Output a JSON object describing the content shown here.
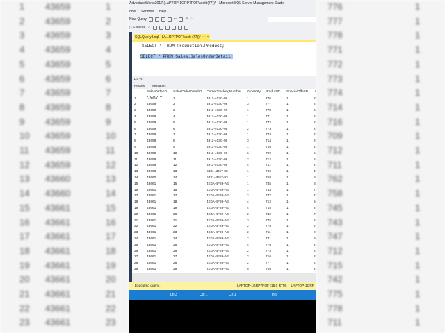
{
  "window": {
    "title": "AdventureWorks2017 (LAPTOP-1GRP7POF\\scott (77))* - Microsoft SQL Server Management Studio"
  },
  "menu": [
    "ools",
    "Window",
    "Help"
  ],
  "toolbar": {
    "new_query": "New Query",
    "execute": "Execute"
  },
  "tab": {
    "label": "SQLQuery3.sql - LA...RP7POF\\scott (77))*",
    "pin": "⊷",
    "close": "×"
  },
  "editor": {
    "line1": "SELECT * FROM Production.Product;",
    "line3": "SELECT * FROM Sales.SalesOrderDetail;"
  },
  "zoom": "110 %",
  "results_tabs": [
    "Results",
    "Messages"
  ],
  "columns": [
    "",
    "SalesOrderID",
    "SalesOrderDetailID",
    "CarrierTrackingNumber",
    "OrderQty",
    "ProductID",
    "SpecialOfferID",
    "U"
  ],
  "rows": [
    [
      "1",
      "43659",
      "1",
      "4911-403C-98",
      "1",
      "776",
      "1",
      "2"
    ],
    [
      "2",
      "43659",
      "2",
      "4911-403C-98",
      "3",
      "777",
      "1",
      "2"
    ],
    [
      "3",
      "43659",
      "3",
      "4911-403C-98",
      "1",
      "778",
      "1",
      "2"
    ],
    [
      "4",
      "43659",
      "4",
      "4911-403C-98",
      "1",
      "771",
      "1",
      "2"
    ],
    [
      "5",
      "43659",
      "5",
      "4911-403C-98",
      "1",
      "772",
      "1",
      "2"
    ],
    [
      "6",
      "43659",
      "6",
      "4911-403C-98",
      "2",
      "773",
      "1",
      "2"
    ],
    [
      "7",
      "43659",
      "7",
      "4911-403C-98",
      "1",
      "774",
      "1",
      "2"
    ],
    [
      "8",
      "43659",
      "8",
      "4911-403C-98",
      "3",
      "714",
      "1",
      "2"
    ],
    [
      "9",
      "43659",
      "9",
      "4911-403C-98",
      "1",
      "716",
      "1",
      "2"
    ],
    [
      "10",
      "43659",
      "10",
      "4911-403C-98",
      "6",
      "709",
      "1",
      "5"
    ],
    [
      "11",
      "43659",
      "11",
      "4911-403C-98",
      "2",
      "712",
      "1",
      "5"
    ],
    [
      "12",
      "43659",
      "12",
      "4911-403C-98",
      "4",
      "711",
      "1",
      "2"
    ],
    [
      "13",
      "43660",
      "13",
      "6431-4D57-83",
      "1",
      "762",
      "1",
      "4"
    ],
    [
      "14",
      "43660",
      "14",
      "6431-4D57-83",
      "1",
      "758",
      "1",
      "8"
    ],
    [
      "15",
      "43661",
      "15",
      "4E0A-4F89-AE",
      "1",
      "745",
      "1",
      "8"
    ],
    [
      "16",
      "43661",
      "16",
      "4E0A-4F89-AE",
      "1",
      "743",
      "1",
      "7"
    ],
    [
      "17",
      "43661",
      "17",
      "4E0A-4F89-AE",
      "2",
      "747",
      "1",
      "7"
    ],
    [
      "18",
      "43661",
      "18",
      "4E0A-4F89-AE",
      "4",
      "712",
      "1",
      "5"
    ],
    [
      "19",
      "43661",
      "19",
      "4E0A-4F89-AE",
      "4",
      "715",
      "1",
      "2"
    ],
    [
      "20",
      "43661",
      "20",
      "4E0A-4F89-AE",
      "2",
      "742",
      "1",
      "7"
    ],
    [
      "21",
      "43661",
      "21",
      "4E0A-4F89-AE",
      "3",
      "775",
      "1",
      "2"
    ],
    [
      "22",
      "43661",
      "22",
      "4E0A-4F89-AE",
      "2",
      "778",
      "1",
      "2"
    ],
    [
      "23",
      "43661",
      "23",
      "4E0A-4F89-AE",
      "2",
      "711",
      "1",
      "2"
    ],
    [
      "24",
      "43661",
      "24",
      "4E0A-4F89-AE",
      "2",
      "741",
      "1",
      "8"
    ],
    [
      "25",
      "43661",
      "25",
      "4E0A-4F89-AE",
      "4",
      "776",
      "1",
      "2"
    ],
    [
      "26",
      "43661",
      "26",
      "4E0A-4F89-AE",
      "2",
      "773",
      "1",
      "2"
    ],
    [
      "27",
      "43661",
      "27",
      "4E0A-4F89-AE",
      "2",
      "716",
      "1",
      "2"
    ],
    [
      "28",
      "43661",
      "28",
      "4E0A-4F89-AE",
      "2",
      "777",
      "1",
      "2"
    ],
    [
      "29",
      "43661",
      "29",
      "4E0A-4F89-AE",
      "5",
      "708",
      "1",
      "2"
    ]
  ],
  "status": {
    "text": "Executing query...",
    "server": "LAPTOP-1GRP7POF (15.0 RTM)",
    "server2": "LAPTOP-1GRP"
  },
  "statusbar": {
    "ln": "Ln 3",
    "col": "Col 1",
    "ch": "Ch 1",
    "mode": "INS"
  }
}
